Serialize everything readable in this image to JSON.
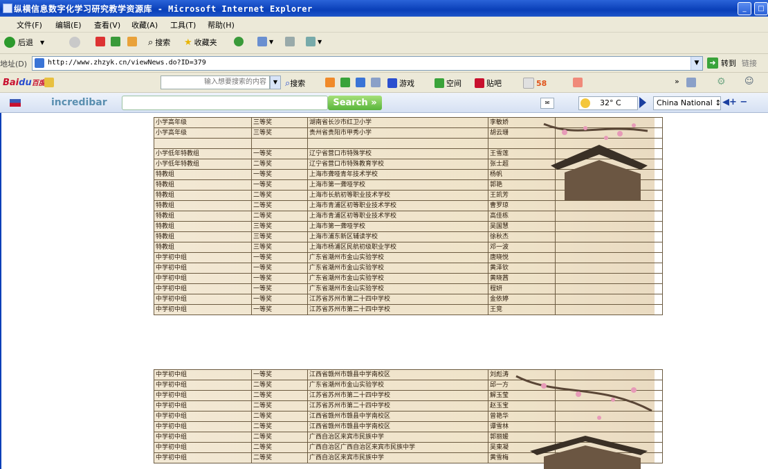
{
  "window": {
    "title": "纵横信息数字化学习研究教学资源库 - Microsoft Internet Explorer",
    "buttons": [
      "_",
      "□"
    ]
  },
  "menu": [
    "文件(F)",
    "编辑(E)",
    "查看(V)",
    "收藏(A)",
    "工具(T)",
    "帮助(H)"
  ],
  "toolbar": {
    "back": "后退",
    "search": "搜索",
    "favorites": "收藏夹"
  },
  "address": {
    "label": "地址(D)",
    "url": "http://www.zhzyk.cn/viewNews.do?ID=379",
    "go": "转到",
    "links": "链接"
  },
  "baidu": {
    "logo_a": "Bai",
    "logo_b": "du",
    "logo_c": "百度",
    "placeholder": "输入想要搜索的内容",
    "search": "搜索",
    "game": "游戏",
    "space": "空间",
    "tieba": "贴吧",
    "count": "58"
  },
  "incredibar": {
    "name": "incredibar",
    "search": "Search",
    "weather": "32° C",
    "channel": "China National ↕",
    "volume": "◀+ −"
  },
  "table1": [
    [
      "小学高年级",
      "三等奖",
      "湖南省长沙市红卫小学",
      "李敏娇",
      ""
    ],
    [
      "小学高年级",
      "三等奖",
      "贵州省贵阳市甲秀小学",
      "胡云珊",
      ""
    ],
    [
      "",
      "",
      "",
      "",
      ""
    ],
    [
      "小学低年特教组",
      "一等奖",
      "辽宁省营口市特殊学校",
      "王雪莲",
      ""
    ],
    [
      "小学低年特教组",
      "二等奖",
      "辽宁省营口市特殊教育学校",
      "张士超",
      ""
    ],
    [
      "特教组",
      "一等奖",
      "上海市聋哑青年技术学校",
      "杨帆",
      ""
    ],
    [
      "特教组",
      "一等奖",
      "上海市第一聋哑学校",
      "郭艳",
      ""
    ],
    [
      "特教组",
      "二等奖",
      "上海市长航初等职业技术学校",
      "王凯芳",
      ""
    ],
    [
      "特教组",
      "二等奖",
      "上海市青浦区初等职业技术学校",
      "曹罗琼",
      ""
    ],
    [
      "特教组",
      "二等奖",
      "上海市青浦区初等职业技术学校",
      "高佳栋",
      ""
    ],
    [
      "特教组",
      "三等奖",
      "上海市第一聋哑学校",
      "吴国慧",
      ""
    ],
    [
      "特教组",
      "三等奖",
      "上海市浦东新区辅读学校",
      "徐秋杰",
      ""
    ],
    [
      "特教组",
      "三等奖",
      "上海市杨浦区民航初级职业学校",
      "邓一波",
      ""
    ],
    [
      "中学初中组",
      "一等奖",
      "广东省潮州市金山实验学校",
      "唐晓悦",
      ""
    ],
    [
      "中学初中组",
      "一等奖",
      "广东省潮州市金山实验学校",
      "黄泽钦",
      ""
    ],
    [
      "中学初中组",
      "一等奖",
      "广东省潮州市金山实验学校",
      "黄晓茜",
      ""
    ],
    [
      "中学初中组",
      "一等奖",
      "广东省潮州市金山实验学校",
      "程妍",
      ""
    ],
    [
      "中学初中组",
      "一等奖",
      "江苏省苏州市第二十四中学校",
      "金依婷",
      ""
    ],
    [
      "中学初中组",
      "一等奖",
      "江苏省苏州市第二十四中学校",
      "王竞",
      ""
    ]
  ],
  "table2": [
    [
      "中学初中组",
      "一等奖",
      "江西省赣州市赣县中学南校区",
      "刘彪涛",
      ""
    ],
    [
      "中学初中组",
      "二等奖",
      "广东省潮州市金山实验学校",
      "邱一方",
      ""
    ],
    [
      "中学初中组",
      "二等奖",
      "江苏省苏州市第二十四中学校",
      "解玉莹",
      ""
    ],
    [
      "中学初中组",
      "二等奖",
      "江苏省苏州市第二十四中学校",
      "赵玉宝",
      ""
    ],
    [
      "中学初中组",
      "二等奖",
      "江西省赣州市赣县中学南校区",
      "曾艳华",
      ""
    ],
    [
      "中学初中组",
      "二等奖",
      "江西省赣州市赣县中学南校区",
      "谭雪林",
      ""
    ],
    [
      "中学初中组",
      "二等奖",
      "广西自治区来宾市民族中学",
      "郭丽媛",
      ""
    ],
    [
      "中学初中组",
      "二等奖",
      "广西自治区广西自治区来宾市民族中学",
      "吴東凝",
      ""
    ],
    [
      "中学初中组",
      "二等奖",
      "广西自治区来宾市民族中学",
      "黄雪梅",
      ""
    ]
  ],
  "colors": {
    "titlebar": "#0a3fb8",
    "chrome": "#ece9d8",
    "table_bg": "#efe3c9"
  }
}
